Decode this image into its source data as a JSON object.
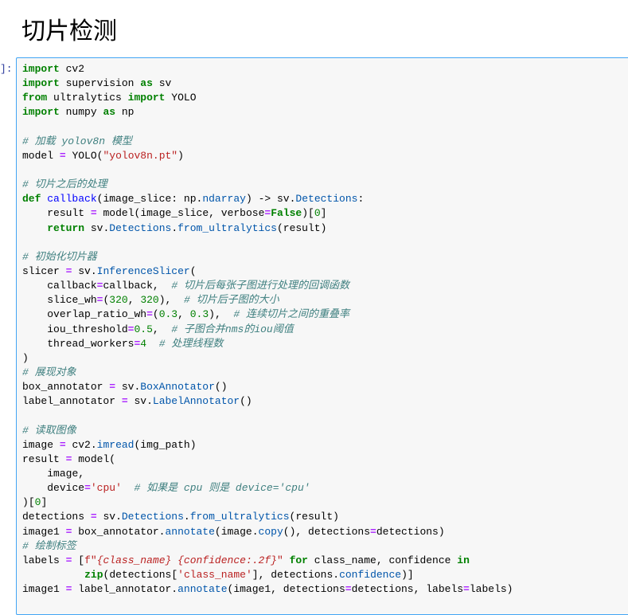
{
  "heading": "切片检测",
  "prompt": "]:",
  "code_lines": [
    "import cv2",
    "import supervision as sv",
    "from ultralytics import YOLO",
    "import numpy as np",
    "",
    "# 加载 yolov8n 模型",
    "model = YOLO(\"yolov8n.pt\")",
    "",
    "# 切片之后的处理",
    "def callback(image_slice: np.ndarray) -> sv.Detections:",
    "    result = model(image_slice, verbose=False)[0]",
    "    return sv.Detections.from_ultralytics(result)",
    "",
    "# 初始化切片器",
    "slicer = sv.InferenceSlicer(",
    "    callback=callback,  # 切片后每张子图进行处理的回调函数",
    "    slice_wh=(320, 320),  # 切片后子图的大小",
    "    overlap_ratio_wh=(0.3, 0.3),  # 连续切片之间的重叠率",
    "    iou_threshold=0.5,  # 子图合并nms的iou阈值",
    "    thread_workers=4  # 处理线程数",
    ")",
    "# 展现对象",
    "box_annotator = sv.BoxAnnotator()",
    "label_annotator = sv.LabelAnnotator()",
    "",
    "# 读取图像",
    "image = cv2.imread(img_path)",
    "result = model(",
    "    image,",
    "    device='cpu'  # 如果是 cpu 则是 device='cpu'",
    ")[0]",
    "detections = sv.Detections.from_ultralytics(result)",
    "image1 = box_annotator.annotate(image.copy(), detections=detections)",
    "# 绘制标签",
    "labels = [f\"{class_name} {confidence:.2f}\" for class_name, confidence in",
    "          zip(detections['class_name'], detections.confidence)]",
    "image1 = label_annotator.annotate(image1, detections=detections, labels=labels)"
  ]
}
